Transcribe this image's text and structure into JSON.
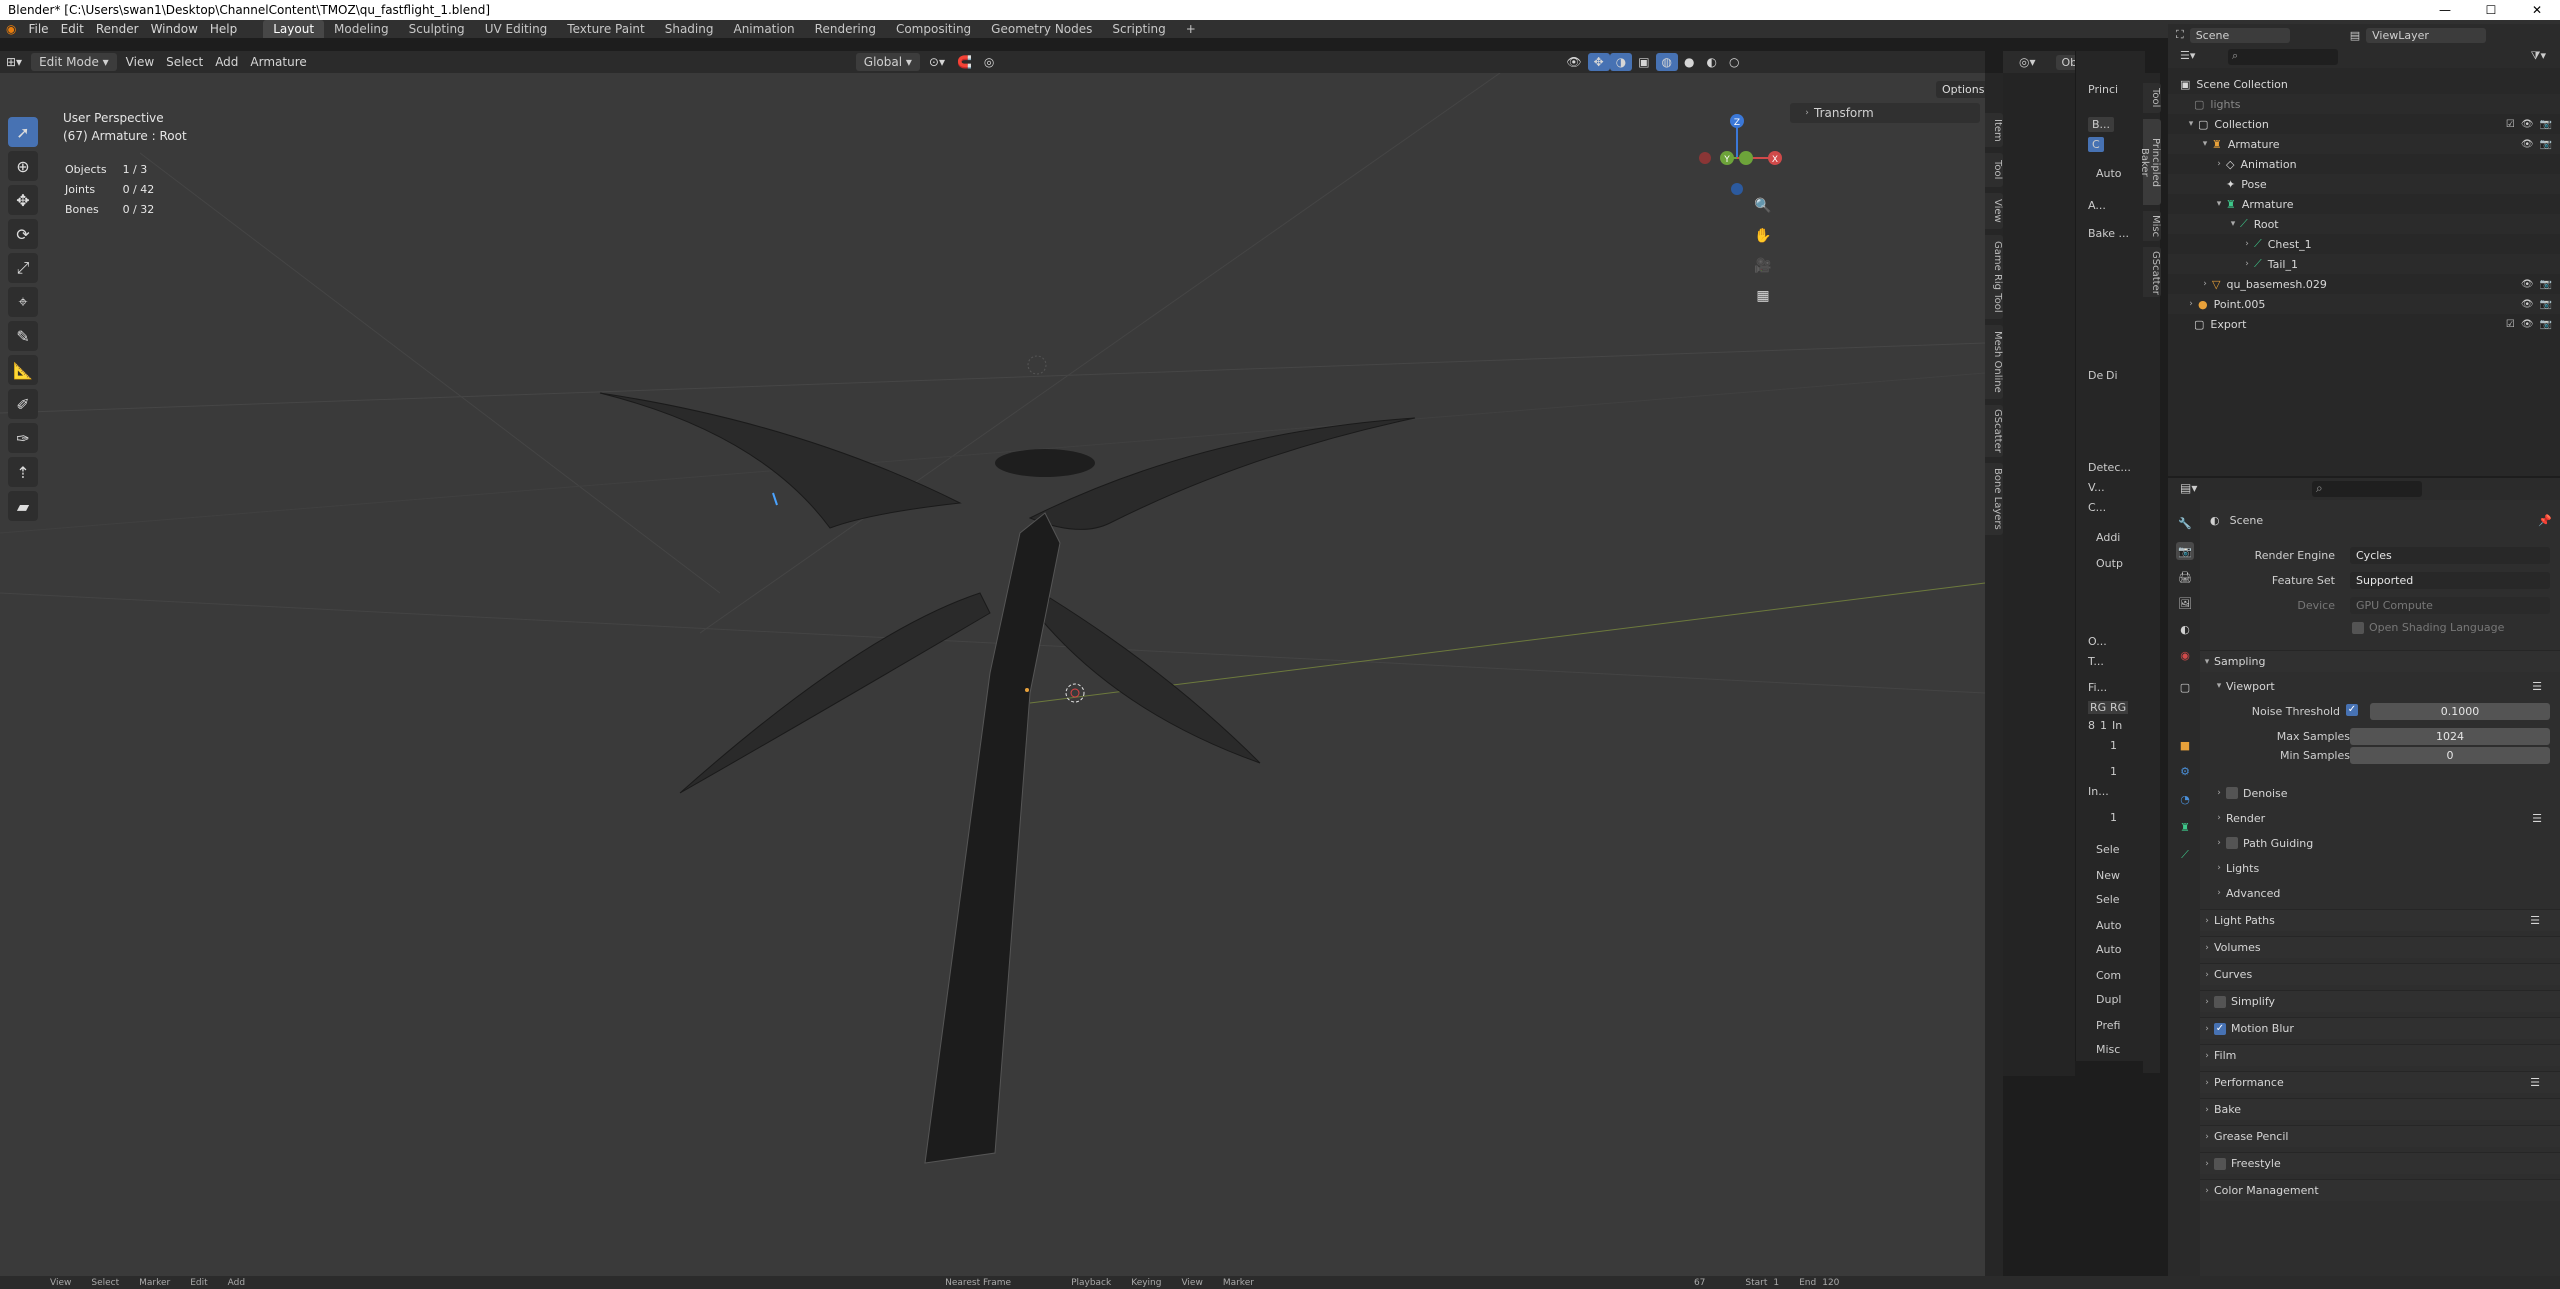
{
  "window": {
    "title": "Blender* [C:\\Users\\swan1\\Desktop\\ChannelContent\\TMOZ\\qu_fastflight_1.blend]",
    "min": "—",
    "max": "☐",
    "close": "✕"
  },
  "menu": {
    "items": [
      "File",
      "Edit",
      "Render",
      "Window",
      "Help"
    ]
  },
  "workspaces": [
    "Layout",
    "Modeling",
    "Sculpting",
    "UV Editing",
    "Texture Paint",
    "Shading",
    "Animation",
    "Rendering",
    "Compositing",
    "Geometry Nodes",
    "Scripting",
    "+"
  ],
  "scene": {
    "name": "Scene",
    "viewlayer": "ViewLayer"
  },
  "viewport_header": {
    "mode": "Edit Mode",
    "menus": [
      "View",
      "Select",
      "Add",
      "Armature"
    ],
    "orientation": "Global",
    "object_label": "Object",
    "options": "Options"
  },
  "viewport": {
    "perspective": "User Perspective",
    "active": "(67) Armature : Root",
    "stats": [
      {
        "label": "Objects",
        "value": "1 / 3"
      },
      {
        "label": "Joints",
        "value": "0 / 42"
      },
      {
        "label": "Bones",
        "value": "0 / 32"
      }
    ],
    "transform_panel": "Transform",
    "gizmo": {
      "x": "X",
      "y": "Y",
      "z": "Z"
    }
  },
  "side_tabs": [
    "Item",
    "Tool",
    "View",
    "Game Rig Tool",
    "Mesh Online",
    "GScatter",
    "Bone Layers"
  ],
  "mid_panel": {
    "tabs": [
      "Tool",
      "Principled Baker",
      "Misc",
      "GScatter"
    ],
    "items": [
      "Princi",
      "B...",
      "Auto",
      "A...",
      "Bake ...",
      "De",
      "Di",
      "Detec...",
      "V...",
      "C...",
      "Addi",
      "Outp",
      "O...",
      "T...",
      "Fi...",
      "RG",
      "RG",
      "8",
      "1",
      "In",
      "1",
      "1",
      "In...",
      "1",
      "Sele",
      "New",
      "Sele",
      "Auto",
      "Auto",
      "Com",
      "Dupl",
      "Prefi",
      "Misc"
    ]
  },
  "outliner": {
    "rows": [
      {
        "label": "Scene Collection",
        "indent": 0
      },
      {
        "label": "lights",
        "indent": 1
      },
      {
        "label": "Collection",
        "indent": 1
      },
      {
        "label": "Armature",
        "indent": 2
      },
      {
        "label": "Animation",
        "indent": 3
      },
      {
        "label": "Pose",
        "indent": 3
      },
      {
        "label": "Armature",
        "indent": 3
      },
      {
        "label": "Root",
        "indent": 4
      },
      {
        "label": "Chest_1",
        "indent": 5
      },
      {
        "label": "Tail_1",
        "indent": 5
      },
      {
        "label": "qu_basemesh.029",
        "indent": 2
      },
      {
        "label": "Point.005",
        "indent": 1
      },
      {
        "label": "Export",
        "indent": 1
      }
    ]
  },
  "properties": {
    "context": "Scene",
    "render_engine_label": "Render Engine",
    "render_engine": "Cycles",
    "feature_set_label": "Feature Set",
    "feature_set": "Supported",
    "device_label": "Device",
    "device": "GPU Compute",
    "osl": "Open Shading Language",
    "sampling": "Sampling",
    "viewport": "Viewport",
    "noise_threshold_label": "Noise Threshold",
    "noise_threshold": "0.1000",
    "max_samples_label": "Max Samples",
    "max_samples": "1024",
    "min_samples_label": "Min Samples",
    "min_samples": "0",
    "denoise": "Denoise",
    "render": "Render",
    "path_guiding": "Path Guiding",
    "lights": "Lights",
    "advanced": "Advanced",
    "sections": [
      "Light Paths",
      "Volumes",
      "Curves",
      "Simplify",
      "Motion Blur",
      "Film",
      "Performance",
      "Bake",
      "Grease Pencil",
      "Freestyle",
      "Color Management"
    ]
  },
  "bottom": {
    "items": [
      "View",
      "Select",
      "Marker",
      "Edit",
      "Add",
      "Nearest Frame",
      "Playback",
      "Keying",
      "View",
      "Marker",
      "67",
      "Start",
      "1",
      "End",
      "120"
    ]
  }
}
